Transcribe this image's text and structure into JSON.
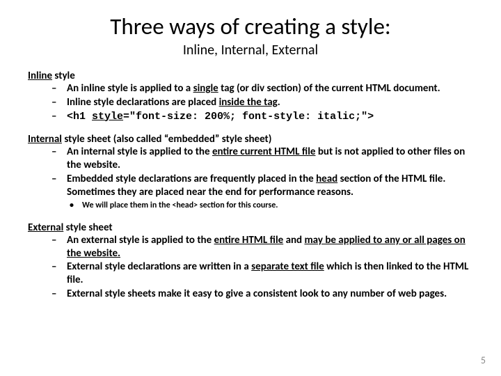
{
  "title": "Three ways of creating a style:",
  "subtitle": "Inline,  Internal,  External",
  "inline": {
    "head_u": "Inline",
    "head_rest": " style",
    "b1_pre": " An inline style is applied to a ",
    "b1_u": "single",
    "b1_post": " tag (or div section) of the current HTML document.",
    "b2_pre": "Inline style declarations are placed ",
    "b2_u": "inside the tag",
    "b2_post": ".",
    "b3_code1": "<h1 ",
    "b3_code_u": "style",
    "b3_code2": "=\"font-size: 200%; font-style: italic;\">"
  },
  "internal": {
    "head_u": "Internal",
    "head_rest": " style sheet (also called “embedded” style sheet)",
    "b1_pre": "An internal style is applied to the ",
    "b1_u": "entire current HTML file",
    "b1_post": " but is not applied to other files on the website.",
    "b2_pre": "Embedded style declarations are frequently placed in the ",
    "b2_u": "head",
    "b2_post": " section of the HTML file. Sometimes they are placed near the end for performance reasons.",
    "sub": "We will place them in the <head> section for this course."
  },
  "external": {
    "head_u": "External",
    "head_rest": " style sheet",
    "b1_pre": "An external style is applied to the ",
    "b1_u": "entire HTML file",
    "b1_mid": " and ",
    "b1_u2": "may be applied to any or all pages on the website.",
    "b2_pre": "External style declarations are written in a ",
    "b2_u": "separate text file",
    "b2_post": " which is then linked to the HTML file.",
    "b3": "External style sheets make it easy to give a consistent look to any number of web pages."
  },
  "page_number": "5"
}
